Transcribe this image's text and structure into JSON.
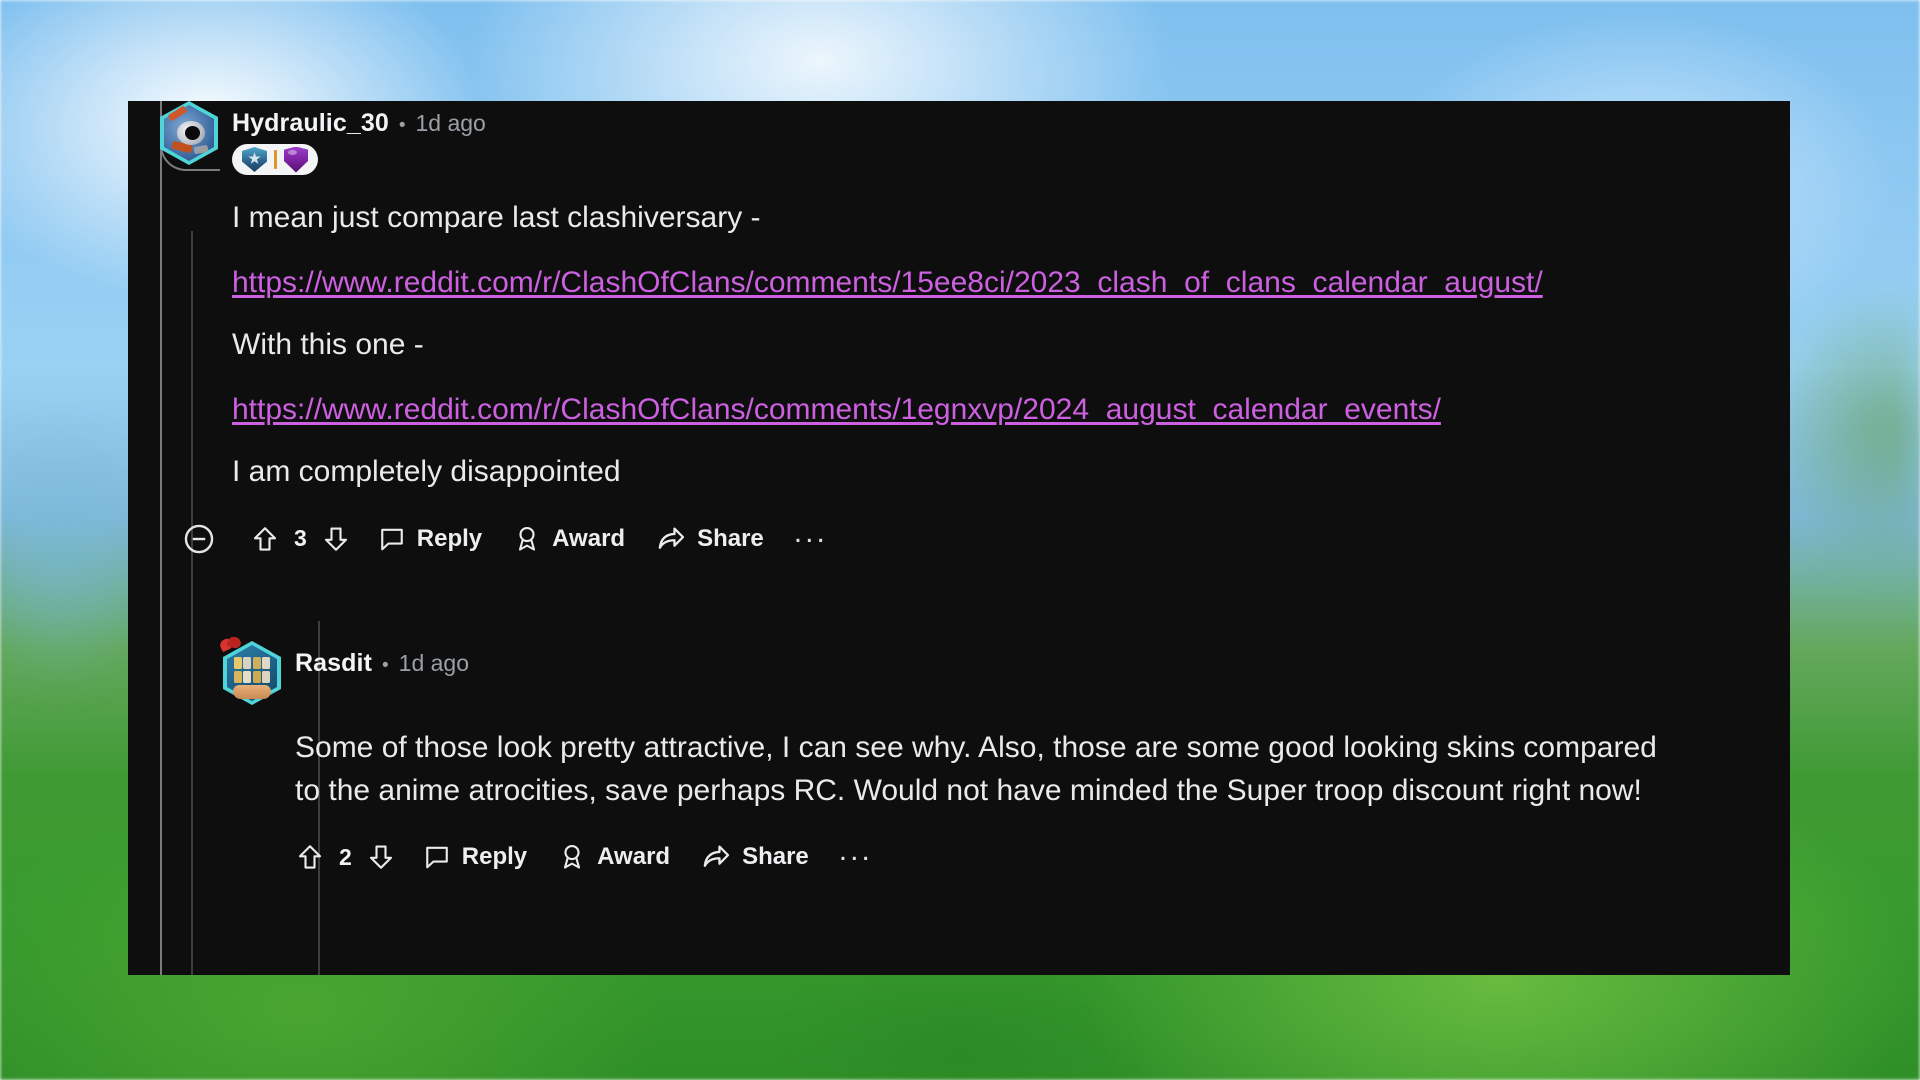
{
  "panel": {
    "background_color": "#0e0e0f",
    "link_color": "#cc60e0"
  },
  "comments": [
    {
      "id": "comment-1",
      "author": "Hydraulic_30",
      "separator": "•",
      "timestamp": "1d ago",
      "avatar_icon": "cannon-avatar-icon",
      "badges": [
        {
          "icon": "clan-badge-icon",
          "label": "clan badge"
        },
        {
          "icon": "league-shield-icon",
          "label": "league shield"
        }
      ],
      "body": [
        {
          "type": "text",
          "text": "I mean just compare last clashiversary -"
        },
        {
          "type": "link",
          "text": "https://www.reddit.com/r/ClashOfClans/comments/15ee8ci/2023_clash_of_clans_calendar_august/"
        },
        {
          "type": "text",
          "text": "With this one -"
        },
        {
          "type": "link",
          "text": "https://www.reddit.com/r/ClashOfClans/comments/1egnxvp/2024_august_calendar_events/"
        },
        {
          "type": "text",
          "text": "I am completely disappointed"
        }
      ],
      "actions": {
        "collapse_label": "collapse thread",
        "upvote_label": "upvote",
        "score": "3",
        "downvote_label": "downvote",
        "reply_label": "Reply",
        "award_label": "Award",
        "share_label": "Share",
        "more_label": "..."
      }
    },
    {
      "id": "comment-2",
      "author": "Rasdit",
      "separator": "•",
      "timestamp": "1d ago",
      "avatar_icon": "calendar-gift-avatar-icon",
      "badges": [],
      "body": [
        {
          "type": "text",
          "text": "Some of those look pretty attractive, I can see why. Also, those are some good looking skins compared to the anime atrocities, save perhaps RC. Would not have minded the Super troop discount right now!"
        }
      ],
      "actions": {
        "upvote_label": "upvote",
        "score": "2",
        "downvote_label": "downvote",
        "reply_label": "Reply",
        "award_label": "Award",
        "share_label": "Share",
        "more_label": "..."
      }
    }
  ]
}
